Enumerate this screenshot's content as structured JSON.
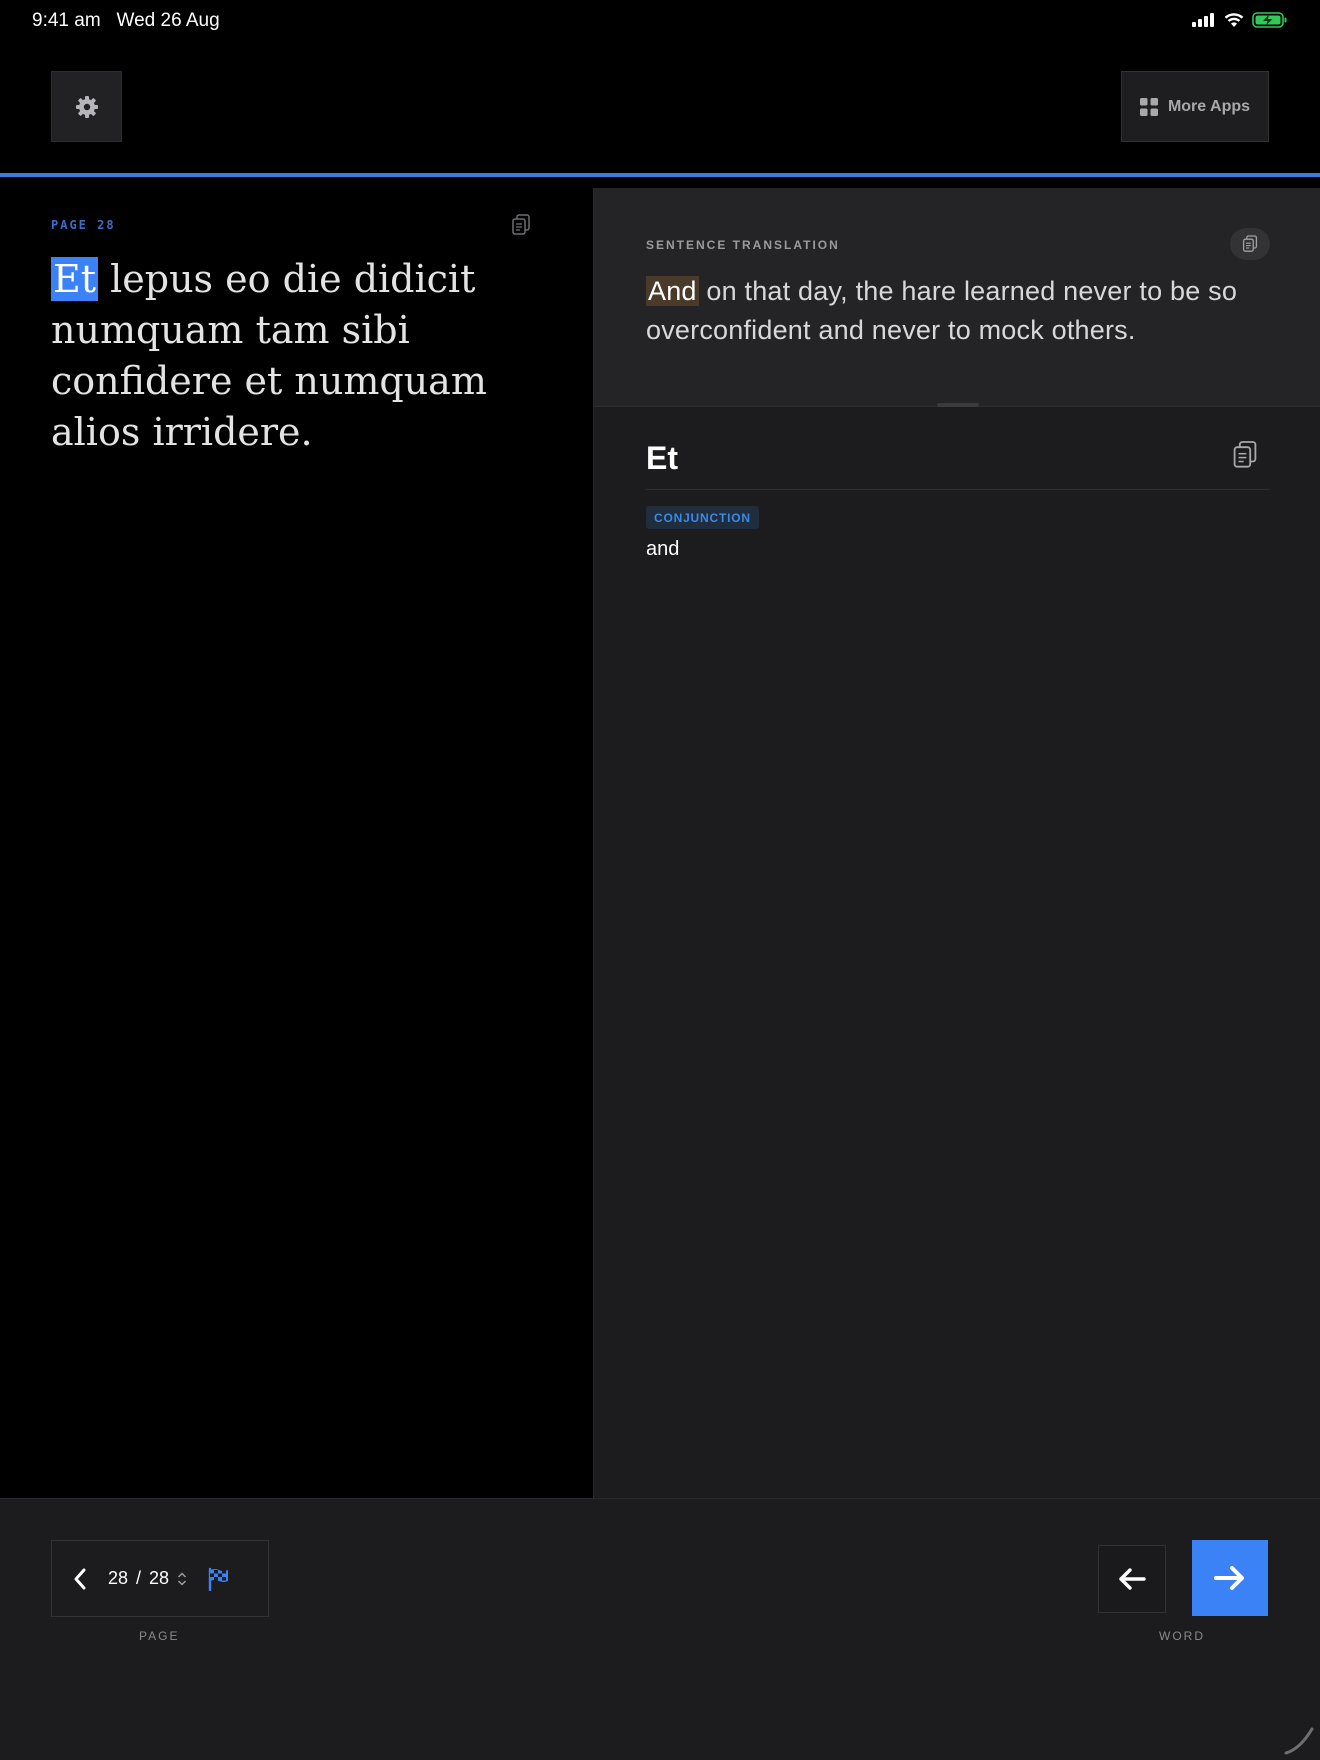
{
  "status_bar": {
    "time": "9:41 am",
    "date": "Wed 26 Aug",
    "icons": [
      "signal-icon",
      "wifi-icon",
      "battery-charging-icon"
    ]
  },
  "toolbar": {
    "settings_icon": "gear-icon",
    "more_apps_label": "More Apps",
    "more_apps_icon": "grid-icon"
  },
  "reader": {
    "page_label": "PAGE 28",
    "copy_icon": "copy-icon",
    "latin_words": [
      "Et",
      "lepus",
      "eo",
      "die",
      "didicit",
      "numquam",
      "tam",
      "sibi",
      "confidere",
      "et",
      "numquam",
      "alios",
      "irridere"
    ],
    "latin_end": "."
  },
  "translation": {
    "label": "SENTENCE TRANSLATION",
    "highlight": "And",
    "part1": "on that day",
    "comma": ",",
    "part2": "the hare learned never to be so overconfident and never to mock others",
    "period": "."
  },
  "word_detail": {
    "word": "Et",
    "part_of_speech": "CONJUNCTION",
    "meaning": "and"
  },
  "bottom_nav": {
    "current_page": "28",
    "separator": "/",
    "total_pages": "28",
    "page_caption": "PAGE",
    "word_caption": "WORD",
    "icons": [
      "chevron-left-icon",
      "updown-chevron-icon",
      "checkered-flag-icon",
      "arrow-left-icon",
      "arrow-right-icon"
    ]
  },
  "colors": {
    "accent": "#3b82f6",
    "badge_text": "#3b8ae6",
    "translation_highlight": "#4a3a2a",
    "panel": "#1c1c1e"
  }
}
